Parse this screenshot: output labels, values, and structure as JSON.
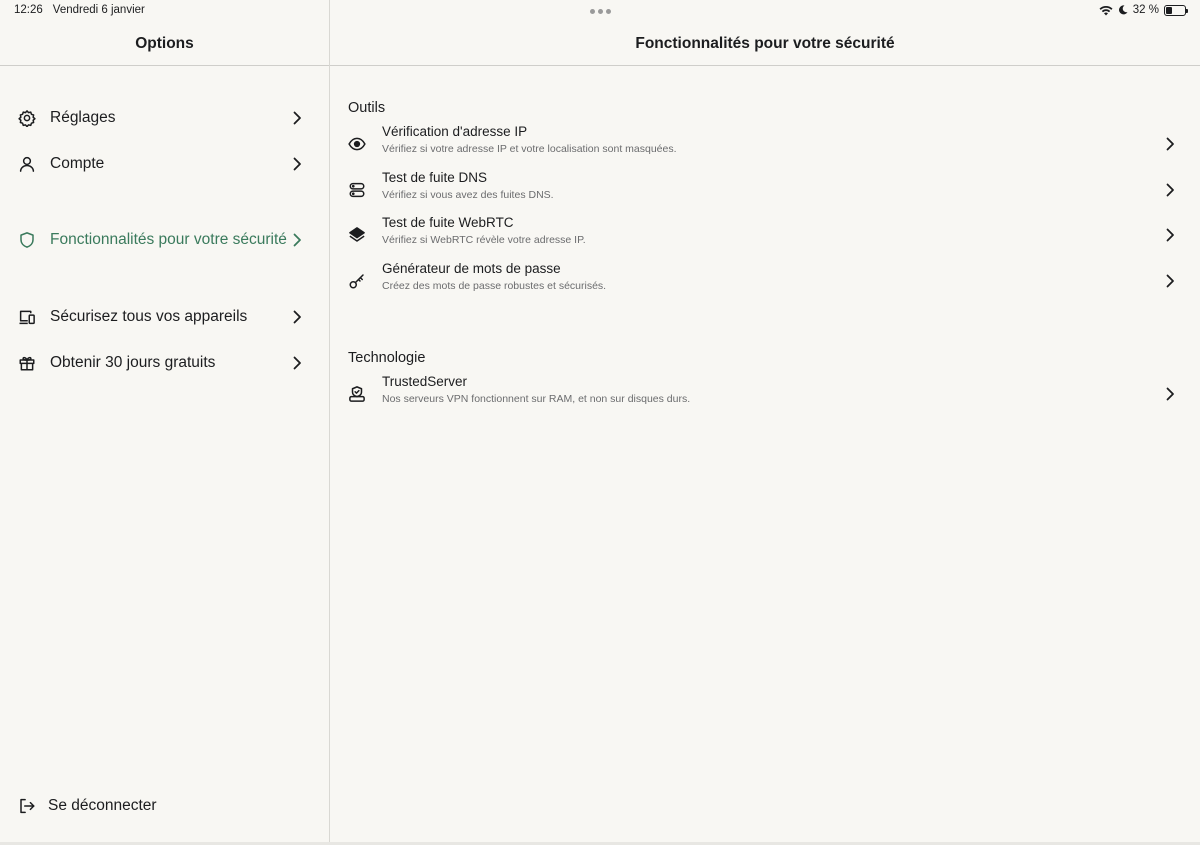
{
  "status_bar": {
    "time": "12:26",
    "date": "Vendredi 6 janvier",
    "battery_text": "32 %",
    "battery_level": 0.32
  },
  "sidebar": {
    "title": "Options",
    "items": [
      {
        "label": "Réglages",
        "icon": "gear-icon"
      },
      {
        "label": "Compte",
        "icon": "person-icon"
      },
      {
        "label": "Fonctionnalités pour votre sécurité",
        "icon": "shield-icon",
        "active": true
      },
      {
        "label": "Sécurisez tous vos appareils",
        "icon": "devices-icon"
      },
      {
        "label": "Obtenir 30 jours gratuits",
        "icon": "gift-icon"
      }
    ],
    "logout_label": "Se déconnecter"
  },
  "main": {
    "title": "Fonctionnalités pour votre sécurité",
    "sections": [
      {
        "title": "Outils",
        "rows": [
          {
            "title": "Vérification d'adresse IP",
            "subtitle": "Vérifiez si votre adresse IP et votre localisation sont masquées.",
            "icon": "eye-icon"
          },
          {
            "title": "Test de fuite DNS",
            "subtitle": "Vérifiez si vous avez des fuites DNS.",
            "icon": "server-icon"
          },
          {
            "title": "Test de fuite WebRTC",
            "subtitle": "Vérifiez si WebRTC révèle votre adresse IP.",
            "icon": "layers-icon"
          },
          {
            "title": "Générateur de mots de passe",
            "subtitle": "Créez des mots de passe robustes et sécurisés.",
            "icon": "key-icon"
          }
        ]
      },
      {
        "title": "Technologie",
        "rows": [
          {
            "title": "TrustedServer",
            "subtitle": "Nos serveurs VPN fonctionnent sur RAM,  et non sur disques durs.",
            "icon": "trusted-server-icon"
          }
        ]
      }
    ]
  },
  "colors": {
    "background": "#f8f7f3",
    "accent": "#3a7a5c",
    "text": "#1c1d1f",
    "subtext": "#6b6c6e"
  }
}
